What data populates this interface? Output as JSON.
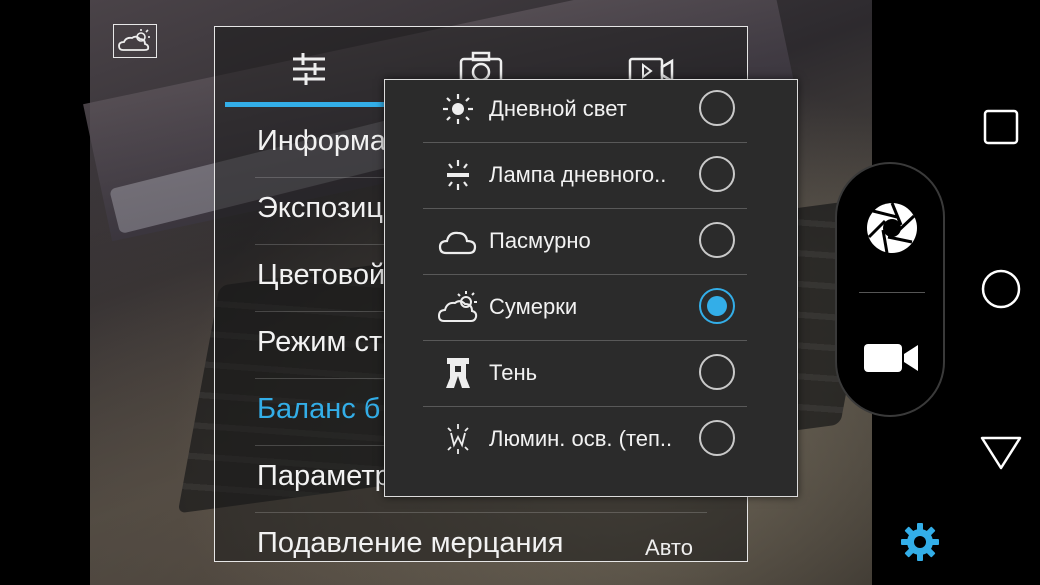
{
  "settings": {
    "tabs": [
      {
        "icon": "sliders-icon"
      },
      {
        "icon": "camera-icon"
      },
      {
        "icon": "video-icon"
      }
    ],
    "items": [
      {
        "label": "Информа",
        "active": false
      },
      {
        "label": "Экспозиц",
        "active": false
      },
      {
        "label": "Цветовой",
        "active": false
      },
      {
        "label": "Режим ст",
        "active": false
      },
      {
        "label": "Баланс б",
        "active": true
      },
      {
        "label": "Параметр",
        "active": false
      },
      {
        "label": "Подавление мерцания",
        "value": "Авто",
        "active": false
      }
    ]
  },
  "white_balance": {
    "options": [
      {
        "label": "Дневной свет",
        "icon": "sun-icon",
        "selected": false
      },
      {
        "label": "Лампа дневного..",
        "icon": "fluorescent-icon",
        "selected": false
      },
      {
        "label": "Пасмурно",
        "icon": "cloud-icon",
        "selected": false
      },
      {
        "label": "Сумерки",
        "icon": "twilight-icon",
        "selected": true
      },
      {
        "label": "Тень",
        "icon": "shade-icon",
        "selected": false
      },
      {
        "label": "Люмин. осв. (теп..",
        "icon": "warm-fluorescent-icon",
        "selected": false
      }
    ]
  },
  "indicators": {
    "current_wb_icon": "twilight-icon"
  },
  "colors": {
    "accent": "#33aee8",
    "panel_border": "#e6e6e6",
    "popup_bg": "#2b2b2b"
  }
}
